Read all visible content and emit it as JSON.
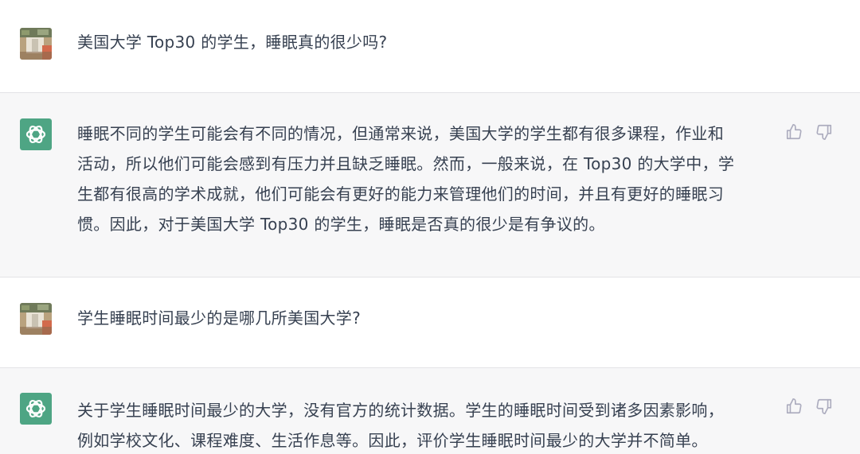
{
  "conversation": [
    {
      "role": "user",
      "avatar": "user-photo-avatar",
      "text": "美国大学 Top30 的学生，睡眠真的很少吗?"
    },
    {
      "role": "assistant",
      "avatar": "openai-logo-icon",
      "text": "睡眠不同的学生可能会有不同的情况，但通常来说，美国大学的学生都有很多课程，作业和\n活动，所以他们可能会感到有压力并且缺乏睡眠。然而，一般来说，在 Top30 的大学中，学\n生都有很高的学术成就，他们可能会有更好的能力来管理他们的时间，并且有更好的睡眠习\n惯。因此，对于美国大学 Top30 的学生，睡眠是否真的很少是有争议的。"
    },
    {
      "role": "user",
      "avatar": "user-photo-avatar",
      "text": "学生睡眠时间最少的是哪几所美国大学?"
    },
    {
      "role": "assistant",
      "avatar": "openai-logo-icon",
      "text": "关于学生睡眠时间最少的大学，没有官方的统计数据。学生的睡眠时间受到诸多因素影响，\n例如学校文化、课程难度、生活作息等。因此，评价学生睡眠时间最少的大学并不简单。"
    }
  ],
  "icons": {
    "like": "thumbs-up-icon",
    "dislike": "thumbs-down-icon"
  },
  "colors": {
    "user_bg": "#ffffff",
    "assistant_bg": "#f7f7f8",
    "bot_avatar": "#4ea584",
    "text": "#374151",
    "icon": "#acacbe"
  }
}
